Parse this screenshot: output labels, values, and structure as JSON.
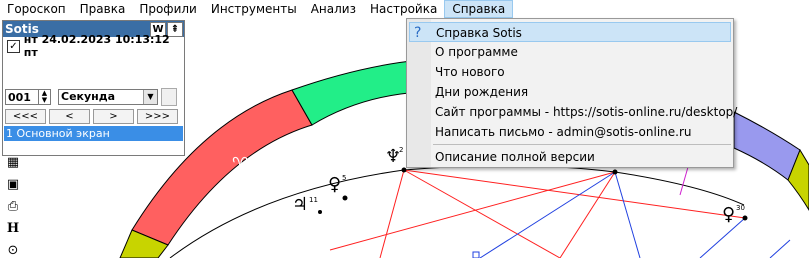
{
  "menubar": {
    "items": [
      "Гороскоп",
      "Правка",
      "Профили",
      "Инструменты",
      "Анализ",
      "Настройка",
      "Справка"
    ],
    "active_index": 6
  },
  "panel": {
    "title": "Sotis",
    "btn_w": "W",
    "datetime": "нт 24.02.2023 10:13:12 пт",
    "checked": true,
    "step_value": "001",
    "unit": "Секунда",
    "nav": [
      "<<<",
      "<",
      ">",
      ">>>"
    ],
    "screen": "1 Основной экран"
  },
  "dropdown": {
    "items": [
      {
        "label": "Справка Sotis",
        "icon": "help-icon"
      },
      {
        "label": "О программе"
      },
      {
        "label": "Что нового"
      },
      {
        "label": "Дни рождения"
      },
      {
        "label": "Сайт программы - https://sotis-online.ru/desktop/"
      },
      {
        "label": "Написать письмо - admin@sotis-online.ru"
      },
      {
        "label": "Описание полной версии"
      }
    ]
  },
  "chart": {
    "sign_glyph": "♈",
    "planets": [
      {
        "glyph": "♃",
        "num": "11"
      },
      {
        "glyph": "♀",
        "num": "5"
      },
      {
        "glyph": "♆",
        "num": "2"
      },
      {
        "glyph": "♀",
        "num": "30"
      }
    ],
    "colors": {
      "aries": "#ff6060",
      "green": "#22ee88",
      "lavender": "#9999ee",
      "yellowgreen": "#c8d400",
      "red_line": "#ff2020",
      "blue_line": "#2040e0"
    }
  },
  "left_toolbar": {
    "icon_h": "H"
  }
}
